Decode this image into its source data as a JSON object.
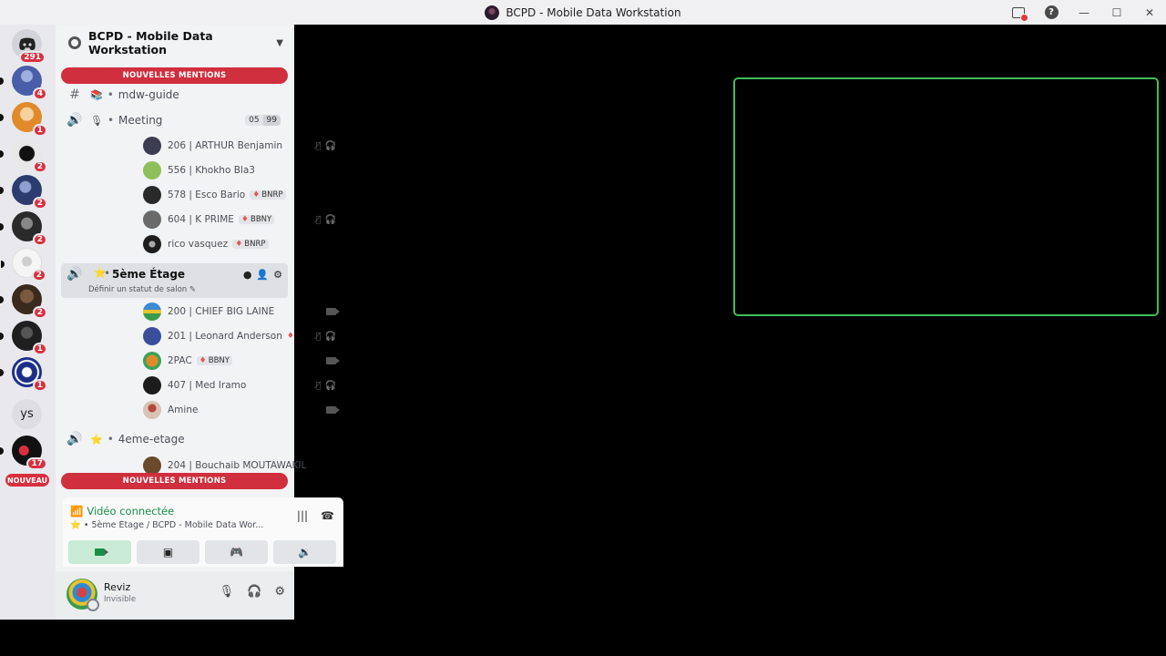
{
  "window": {
    "title": "BCPD - Mobile Data Workstation"
  },
  "servers": [
    {
      "badge": "291",
      "kind": "discord"
    },
    {
      "badge": "4",
      "color": "#4a5da8"
    },
    {
      "badge": "1",
      "color": "#e08a2a"
    },
    {
      "badge": "2",
      "color": "#e8e8e8"
    },
    {
      "badge": "2",
      "color": "#2c3c6e"
    },
    {
      "badge": "2",
      "color": "#2a2a2a"
    },
    {
      "badge": "2",
      "color": "#f5f5f5"
    },
    {
      "badge": "2",
      "color": "#3a2a1e"
    },
    {
      "badge": "1",
      "color": "#1f1f1f"
    },
    {
      "badge": "1",
      "color": "#1b2f86"
    },
    {
      "text": "ys"
    },
    {
      "badge": "17",
      "color": "#111111"
    }
  ],
  "rail_new_label": "NOUVEAU",
  "guild": {
    "name": "BCPD - Mobile Data Workstation"
  },
  "mentions_label": "NOUVELLES MENTIONS",
  "channels": {
    "guide": {
      "name": "mdw-guide"
    },
    "meeting": {
      "name": "Meeting",
      "limit_current": "05",
      "limit_max": "99"
    },
    "active": {
      "name": "5ème Étage",
      "status": "Définir un statut de salon"
    },
    "fourth": {
      "name": "4eme-etage"
    }
  },
  "meeting_users": [
    {
      "name": "206 | ARTHUR Benjamin",
      "tag": "",
      "muted": true,
      "color": "#3c3d52"
    },
    {
      "name": "556 | Khokho Bla3",
      "tag": "",
      "muted": false,
      "color": "#8fbf5a"
    },
    {
      "name": "578 | Esco Bario",
      "tag": "BNRP",
      "muted": false,
      "color": "#2a2a2a"
    },
    {
      "name": "604 | K PRIME",
      "tag": "BBNY",
      "muted": true,
      "color": "#6a6a6a"
    },
    {
      "name": "rico vasquez",
      "tag": "BNRP",
      "muted": false,
      "color": "#1d1d1d"
    }
  ],
  "active_users": [
    {
      "name": "200 | CHIEF BIG LAINE",
      "tag": "",
      "icon": "camera",
      "color": "#3f8ad1"
    },
    {
      "name": "201 | Leonard Anderson",
      "tag": "",
      "icon": "muted",
      "color": "#3a4f9a"
    },
    {
      "name": "2PAC",
      "tag": "BBNY",
      "icon": "camera",
      "color": "#e08a2a"
    },
    {
      "name": "407 | Med Iramo",
      "tag": "",
      "icon": "muted",
      "color": "#1c1c1c"
    },
    {
      "name": "Amine",
      "tag": "",
      "icon": "camera",
      "color": "#d9c3b5"
    }
  ],
  "fourth_users": [
    {
      "name": "204 | Bouchaib MOUTAWAKIL",
      "color": "#6a4a2a"
    }
  ],
  "voice_panel": {
    "status": "Vidéo connectée",
    "subtitle": "5ème Étage / BCPD - Mobile Data Wor..."
  },
  "user": {
    "name": "Reviz",
    "status": "Invisible"
  }
}
